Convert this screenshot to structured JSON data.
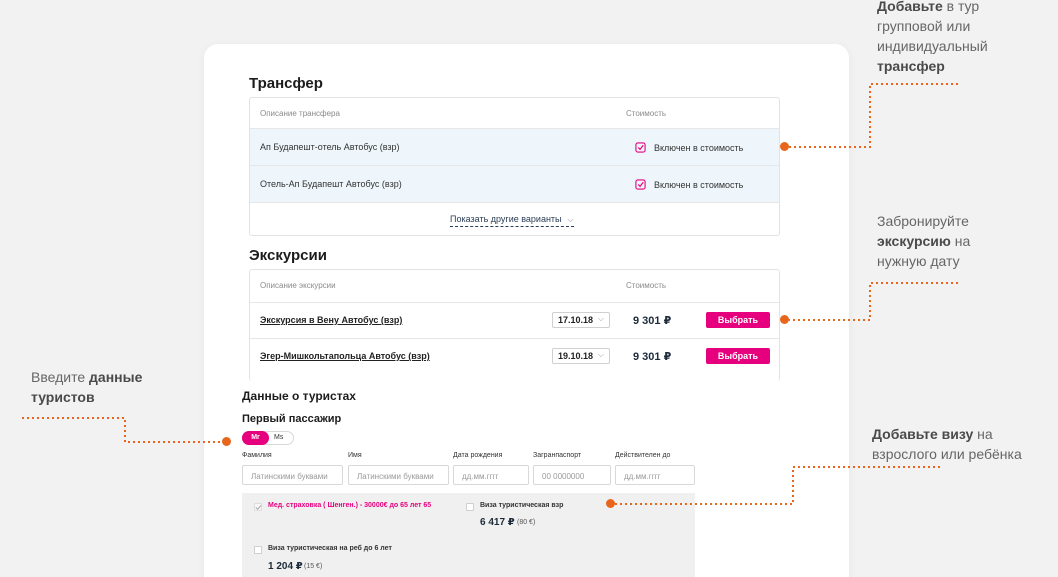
{
  "transfer": {
    "title": "Трансфер",
    "col_desc": "Описание трансфера",
    "col_cost": "Стоимость",
    "rows": [
      {
        "desc": "Ап Будапешт-отель Автобус (взр)",
        "cost": "Включен в стоимость"
      },
      {
        "desc": "Отель-Ап Будапешт Автобус (взр)",
        "cost": "Включен в стоимость"
      }
    ],
    "more": "Показать другие варианты"
  },
  "excursions": {
    "title": "Экскурсии",
    "col_desc": "Описание экскурсии",
    "col_cost": "Стоимость",
    "rows": [
      {
        "name": "Экскурсия в Вену Автобус (взр)",
        "date": "17.10.18",
        "price": "9 301 ₽",
        "button": "Выбрать"
      },
      {
        "name": "Эгер-Мишкольтапольца Автобус (взр)",
        "date": "19.10.18",
        "price": "9 301 ₽",
        "button": "Выбрать"
      }
    ]
  },
  "tourists": {
    "title": "Данные о туристах",
    "passenger": "Первый пассажир",
    "mr": "Mr",
    "ms": "Ms",
    "fields": [
      {
        "label": "Фамилия",
        "placeholder": "Латинскими буквами"
      },
      {
        "label": "Имя",
        "placeholder": "Латинскими буквами"
      },
      {
        "label": "Дата рождения",
        "placeholder": "дд.мм.гггг"
      },
      {
        "label": "Загранпаспорт",
        "placeholder": "00 0000000"
      },
      {
        "label": "Действителен до",
        "placeholder": "дд.мм.гггг"
      }
    ],
    "insurance": "Мед. страховка ( Шенген.) - 30000€ до 65 лет 65",
    "visa_adult": {
      "label": "Виза туристическая взр",
      "price": "6 417 ₽",
      "eur": "(80 €)"
    },
    "visa_child": {
      "label": "Виза туристическая на реб до 6 лет",
      "price": "1 204 ₽",
      "eur": "(15 €)"
    }
  },
  "annotations": {
    "transfer": {
      "b1": "Добавьте",
      "t1": " в тур",
      "t2": "групповой или",
      "t3": "индивидуальный",
      "b2": "трансфер"
    },
    "excursion": {
      "t1": "Забронируйте",
      "b1": "экскурсию",
      "t2": " на",
      "t3": "нужную дату"
    },
    "tourists": {
      "t1": "Введите ",
      "b1": "данные",
      "b2": "туристов"
    },
    "visa": {
      "b1": "Добавьте визу",
      "t1": " на",
      "t2": "взрослого или ребёнка"
    }
  },
  "colors": {
    "accent": "#e6007e",
    "annotation": "#e8661c",
    "row_alt": "#eef6fb"
  }
}
